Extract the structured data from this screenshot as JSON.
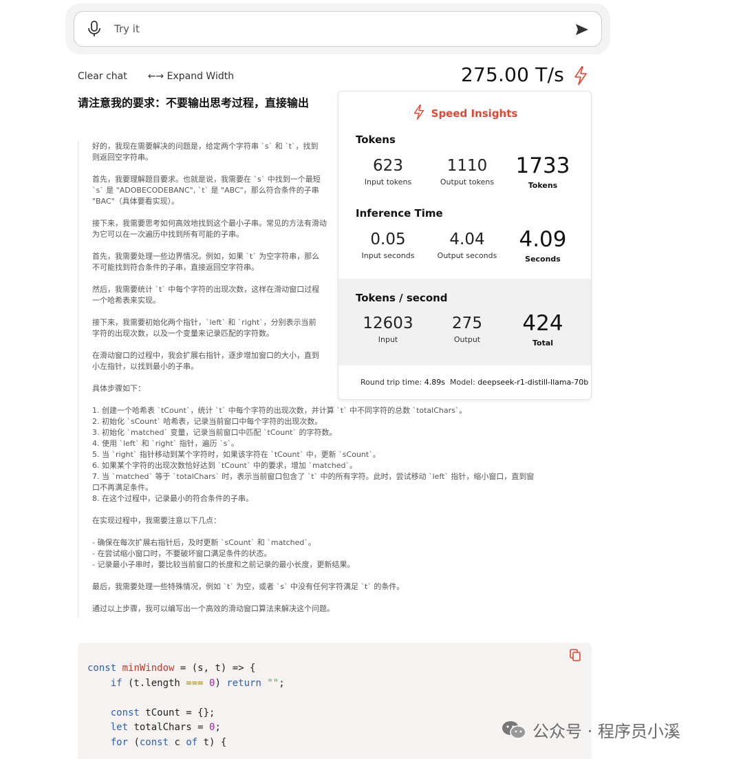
{
  "input": {
    "placeholder": "Try it"
  },
  "toolbar": {
    "clear_chat": "Clear chat",
    "expand_width": "←→ Expand Width"
  },
  "speed": {
    "value": "275.00 T/s"
  },
  "prompt": "请注意我的要求：不要输出思考过程，直接输出",
  "reasoning": {
    "p1": [
      "好的，我现在需要解决的问题是，给定两个字符串 `s` 和 `t`，找到",
      "则返回空字符串。"
    ],
    "p2": [
      "首先，我要理解题目要求。也就是说，我需要在 `s` 中找到一个最短",
      "`s` 是 \"ADOBECODEBANC\", `t` 是 \"ABC\"，那么符合条件的子串",
      "\"BAC\"（具体要看实现）。"
    ],
    "p3": [
      "接下来，我需要思考如何高效地找到这个最小子串。常见的方法有滑动",
      "为它可以在一次遍历中找到所有可能的子串。"
    ],
    "p4": [
      "首先，我需要处理一些边界情况。例如，如果 `t` 为空字符串，那么",
      "不可能找到符合条件的子串，直接返回空字符串。"
    ],
    "p5": [
      "然后，我需要统计 `t` 中每个字符的出现次数，这样在滑动窗口过程",
      "一个哈希表来实现。"
    ],
    "p6": [
      "接下来，我需要初始化两个指针，`left` 和 `right`，分别表示当前",
      "字符的出现次数，以及一个变量来记录匹配的字符数。"
    ],
    "p7": [
      "在滑动窗口的过程中，我会扩展右指针，逐步增加窗口的大小，直到",
      "小左指针，以找到最小的子串。"
    ],
    "p8": "具体步骤如下：",
    "steps": [
      "1. 创建一个哈希表 `tCount`，统计 `t` 中每个字符的出现次数，并计算 `t` 中不同字符的总数 `totalChars`。",
      "2. 初始化 `sCount` 哈希表，记录当前窗口中每个字符的出现次数。",
      "3. 初始化 `matched` 变量，记录当前窗口中匹配 `tCount` 的字符数。",
      "4. 使用 `left` 和 `right` 指针，遍历 `s`。",
      "5. 当 `right` 指针移动到某个字符时，如果该字符在 `tCount` 中，更新 `sCount`。",
      "6. 如果某个字符的出现次数恰好达到 `tCount` 中的要求，增加 `matched`。",
      "7. 当 `matched` 等于 `totalChars` 时，表示当前窗口包含了 `t` 中的所有字符。此时，尝试移动 `left` 指针，缩小窗口，直到窗",
      "口不再满足条件。",
      "8. 在这个过程中，记录最小的符合条件的子串。"
    ],
    "p9": "在实现过程中，我需要注意以下几点：",
    "notes": [
      "- 确保在每次扩展右指针后，及时更新 `sCount` 和 `matched`。",
      "- 在尝试缩小窗口时，不要破坏窗口满足条件的状态。",
      "- 记录最小子串时，要比较当前窗口的长度和之前记录的最小长度，更新结果。"
    ],
    "p10": "最后，我需要处理一些特殊情况，例如 `t` 为空，或者 `s` 中没有任何字符满足 `t` 的条件。",
    "p11": "通过以上步骤，我可以编写出一个高效的滑动窗口算法来解决这个问题。"
  },
  "insights": {
    "title": "Speed Insights",
    "tokens": {
      "title": "Tokens",
      "input_val": "623",
      "input_lbl": "Input tokens",
      "output_val": "1110",
      "output_lbl": "Output tokens",
      "total_val": "1733",
      "total_lbl": "Tokens"
    },
    "inference": {
      "title": "Inference Time",
      "input_val": "0.05",
      "input_lbl": "Input seconds",
      "output_val": "4.04",
      "output_lbl": "Output seconds",
      "total_val": "4.09",
      "total_lbl": "Seconds"
    },
    "tps": {
      "title": "Tokens / second",
      "input_val": "12603",
      "input_lbl": "Input",
      "output_val": "275",
      "output_lbl": "Output",
      "total_val": "424",
      "total_lbl": "Total"
    },
    "footer": {
      "rtt_label": "Round trip time: ",
      "rtt_value": "4.89s",
      "model_label": "Model: ",
      "model_value": "deepseek-r1-distill-llama-70b"
    }
  },
  "code": {
    "l1": {
      "kw": "const",
      "fn": "minWindow",
      "rest1": " = (",
      "a": "s",
      "rest2": ", ",
      "b": "t",
      "rest3": ") => {"
    },
    "l2": {
      "kw": "if",
      "rest1": " (t.length ",
      "op": "===",
      "num": "0",
      "rest2": ") ",
      "kw2": "return",
      "str": "\"\"",
      "end": ";"
    },
    "l4": {
      "kw": "const",
      "rest": " tCount = {};"
    },
    "l5": {
      "kw": "let",
      "rest": " totalChars = ",
      "num": "0",
      "end": ";"
    },
    "l6": {
      "kw": "for",
      "rest1": " (",
      "kw2": "const",
      "rest2": " c ",
      "kw3": "of",
      "rest3": " t) {"
    }
  },
  "watermark": "公众号 · 程序员小溪"
}
